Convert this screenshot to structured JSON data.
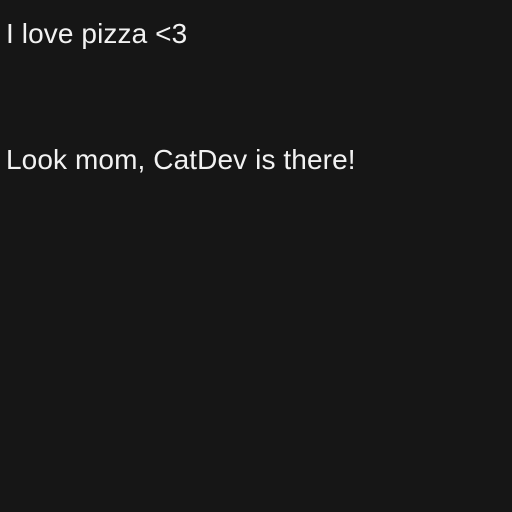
{
  "content": {
    "line_1": "I love pizza <3",
    "line_2": "Look mom, CatDev is there!"
  },
  "colors": {
    "background": "#161616",
    "text": "#f2f2f2"
  }
}
